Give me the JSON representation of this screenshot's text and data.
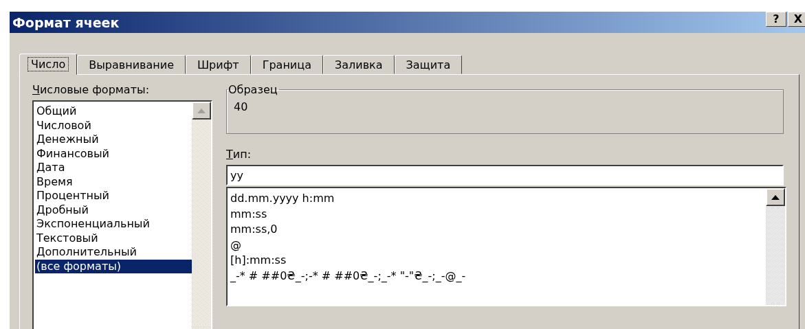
{
  "window": {
    "title": "Формат ячеек",
    "buttons": [
      "?",
      "X"
    ]
  },
  "tabs": [
    {
      "label": "Число",
      "selected": true
    },
    {
      "label": "Выравнивание",
      "selected": false
    },
    {
      "label": "Шрифт",
      "selected": false
    },
    {
      "label": "Граница",
      "selected": false
    },
    {
      "label": "Заливка",
      "selected": false
    },
    {
      "label": "Защита",
      "selected": false
    }
  ],
  "categories": {
    "label": "Числовые форматы:",
    "items": [
      {
        "label": "Общий",
        "selected": false
      },
      {
        "label": "Числовой",
        "selected": false
      },
      {
        "label": "Денежный",
        "selected": false
      },
      {
        "label": "Финансовый",
        "selected": false
      },
      {
        "label": "Дата",
        "selected": false
      },
      {
        "label": "Время",
        "selected": false
      },
      {
        "label": "Процентный",
        "selected": false
      },
      {
        "label": "Дробный",
        "selected": false
      },
      {
        "label": "Экспоненциальный",
        "selected": false
      },
      {
        "label": "Текстовый",
        "selected": false
      },
      {
        "label": "Дополнительный",
        "selected": false
      },
      {
        "label": "(все форматы)",
        "selected": true
      }
    ]
  },
  "sample": {
    "legend": "Образец",
    "value": "40"
  },
  "type": {
    "label": "Тип:",
    "value": "yy",
    "items": [
      "dd.mm.yyyy h:mm",
      "mm:ss",
      "mm:ss,0",
      "@",
      "[h]:mm:ss",
      "_-* # ##0₴_-;-* # ##0₴_-;_-* \"-\"₴_-;_-@_-"
    ]
  }
}
